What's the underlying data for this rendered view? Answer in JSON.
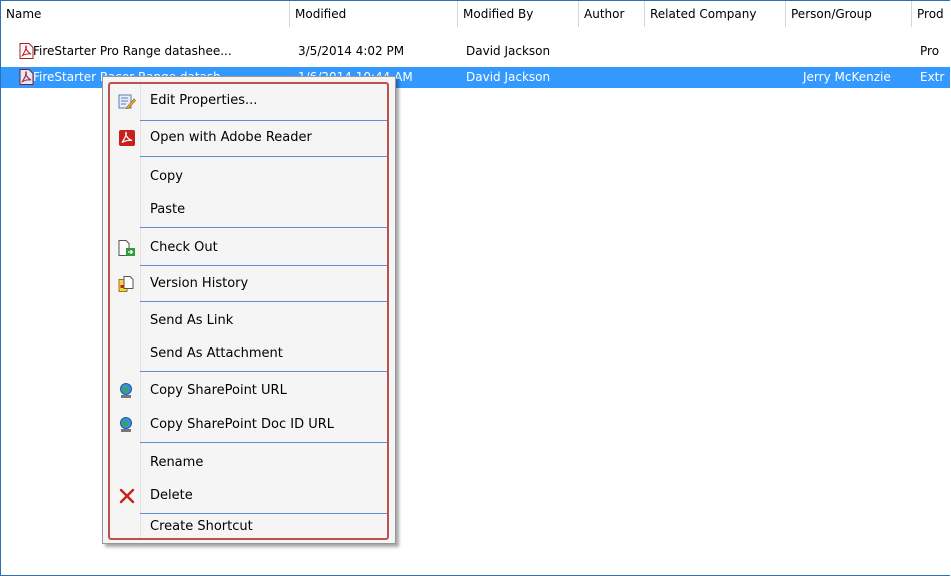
{
  "columns": [
    "Name",
    "Modified",
    "Modified By",
    "Author",
    "Related Company",
    "Person/Group",
    "Prod"
  ],
  "rows": [
    {
      "name": "FireStarter Pro Range datashee...",
      "modified": "3/5/2014 4:02 PM",
      "modified_by": "David Jackson",
      "author": "",
      "related_company": "",
      "person_group": "",
      "product": "Pro"
    },
    {
      "name": "FireStarter Racer Range datash...",
      "modified": "1/6/2014 10:44 AM",
      "modified_by": "David Jackson",
      "author": "",
      "related_company": "",
      "person_group": "Jerry McKenzie",
      "product": "Extr"
    }
  ],
  "context_menu": {
    "items": [
      {
        "label": "Edit Properties...",
        "icon": "edit-properties-icon"
      },
      {
        "label": "Open with Adobe Reader",
        "icon": "adobe-pdf-icon"
      },
      {
        "label": "Copy",
        "icon": ""
      },
      {
        "label": "Paste",
        "icon": ""
      },
      {
        "label": "Check Out",
        "icon": "check-out-icon"
      },
      {
        "label": "Version History",
        "icon": "version-history-icon"
      },
      {
        "label": "Send As Link",
        "icon": ""
      },
      {
        "label": "Send As Attachment",
        "icon": ""
      },
      {
        "label": "Copy SharePoint URL",
        "icon": "sharepoint-globe-icon"
      },
      {
        "label": "Copy SharePoint Doc ID URL",
        "icon": "sharepoint-globe-icon"
      },
      {
        "label": "Rename",
        "icon": ""
      },
      {
        "label": "Delete",
        "icon": "delete-x-icon"
      },
      {
        "label": "Create Shortcut",
        "icon": ""
      }
    ]
  },
  "colors": {
    "selection": "#3399ff",
    "menu_highlight_border": "#c0504d",
    "separator": "#5a8fd6",
    "frame": "#2f6fb3"
  }
}
